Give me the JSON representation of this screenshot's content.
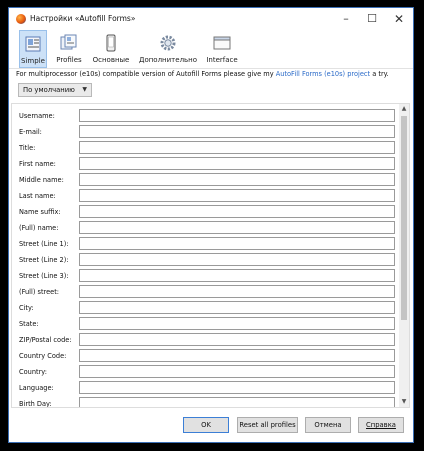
{
  "window": {
    "title": "Настройки «Autofill Forms»",
    "controls": {
      "minimize": "–",
      "maximize": "☐",
      "close": "✕"
    }
  },
  "toolbar": {
    "tabs": [
      {
        "label": "Simple",
        "icon": "simple-profile-icon",
        "active": true
      },
      {
        "label": "Profiles",
        "icon": "profiles-icon",
        "active": false
      },
      {
        "label": "Основные",
        "icon": "phone-main-icon",
        "active": false
      },
      {
        "label": "Дополнительно",
        "icon": "gear-icon",
        "active": false
      },
      {
        "label": "Interface",
        "icon": "window-interface-icon",
        "active": false
      }
    ]
  },
  "notice": {
    "prefix": "For multiprocessor (e10s) compatible version of Autofill Forms please give my",
    "link": "AutoFill Forms (e10s) project",
    "suffix": "a try."
  },
  "profile_select": {
    "value": "По умолчанию"
  },
  "fields": [
    {
      "label": "Username:",
      "value": ""
    },
    {
      "label": "E-mail:",
      "value": ""
    },
    {
      "label": "Title:",
      "value": ""
    },
    {
      "label": "First name:",
      "value": ""
    },
    {
      "label": "Middle name:",
      "value": ""
    },
    {
      "label": "Last name:",
      "value": ""
    },
    {
      "label": "Name suffix:",
      "value": ""
    },
    {
      "label": "(Full) name:",
      "value": ""
    },
    {
      "label": "Street (Line 1):",
      "value": ""
    },
    {
      "label": "Street (Line 2):",
      "value": ""
    },
    {
      "label": "Street (Line 3):",
      "value": ""
    },
    {
      "label": "(Full) street:",
      "value": ""
    },
    {
      "label": "City:",
      "value": ""
    },
    {
      "label": "State:",
      "value": ""
    },
    {
      "label": "ZIP/Postal code:",
      "value": ""
    },
    {
      "label": "Country Code:",
      "value": ""
    },
    {
      "label": "Country:",
      "value": ""
    },
    {
      "label": "Language:",
      "value": ""
    },
    {
      "label": "Birth Day:",
      "value": ""
    }
  ],
  "scrollbar": {
    "up": "▲",
    "down": "▼"
  },
  "buttons": {
    "ok": "OK",
    "reset": "Reset all profiles",
    "cancel": "Отмена",
    "help": "Справка"
  }
}
